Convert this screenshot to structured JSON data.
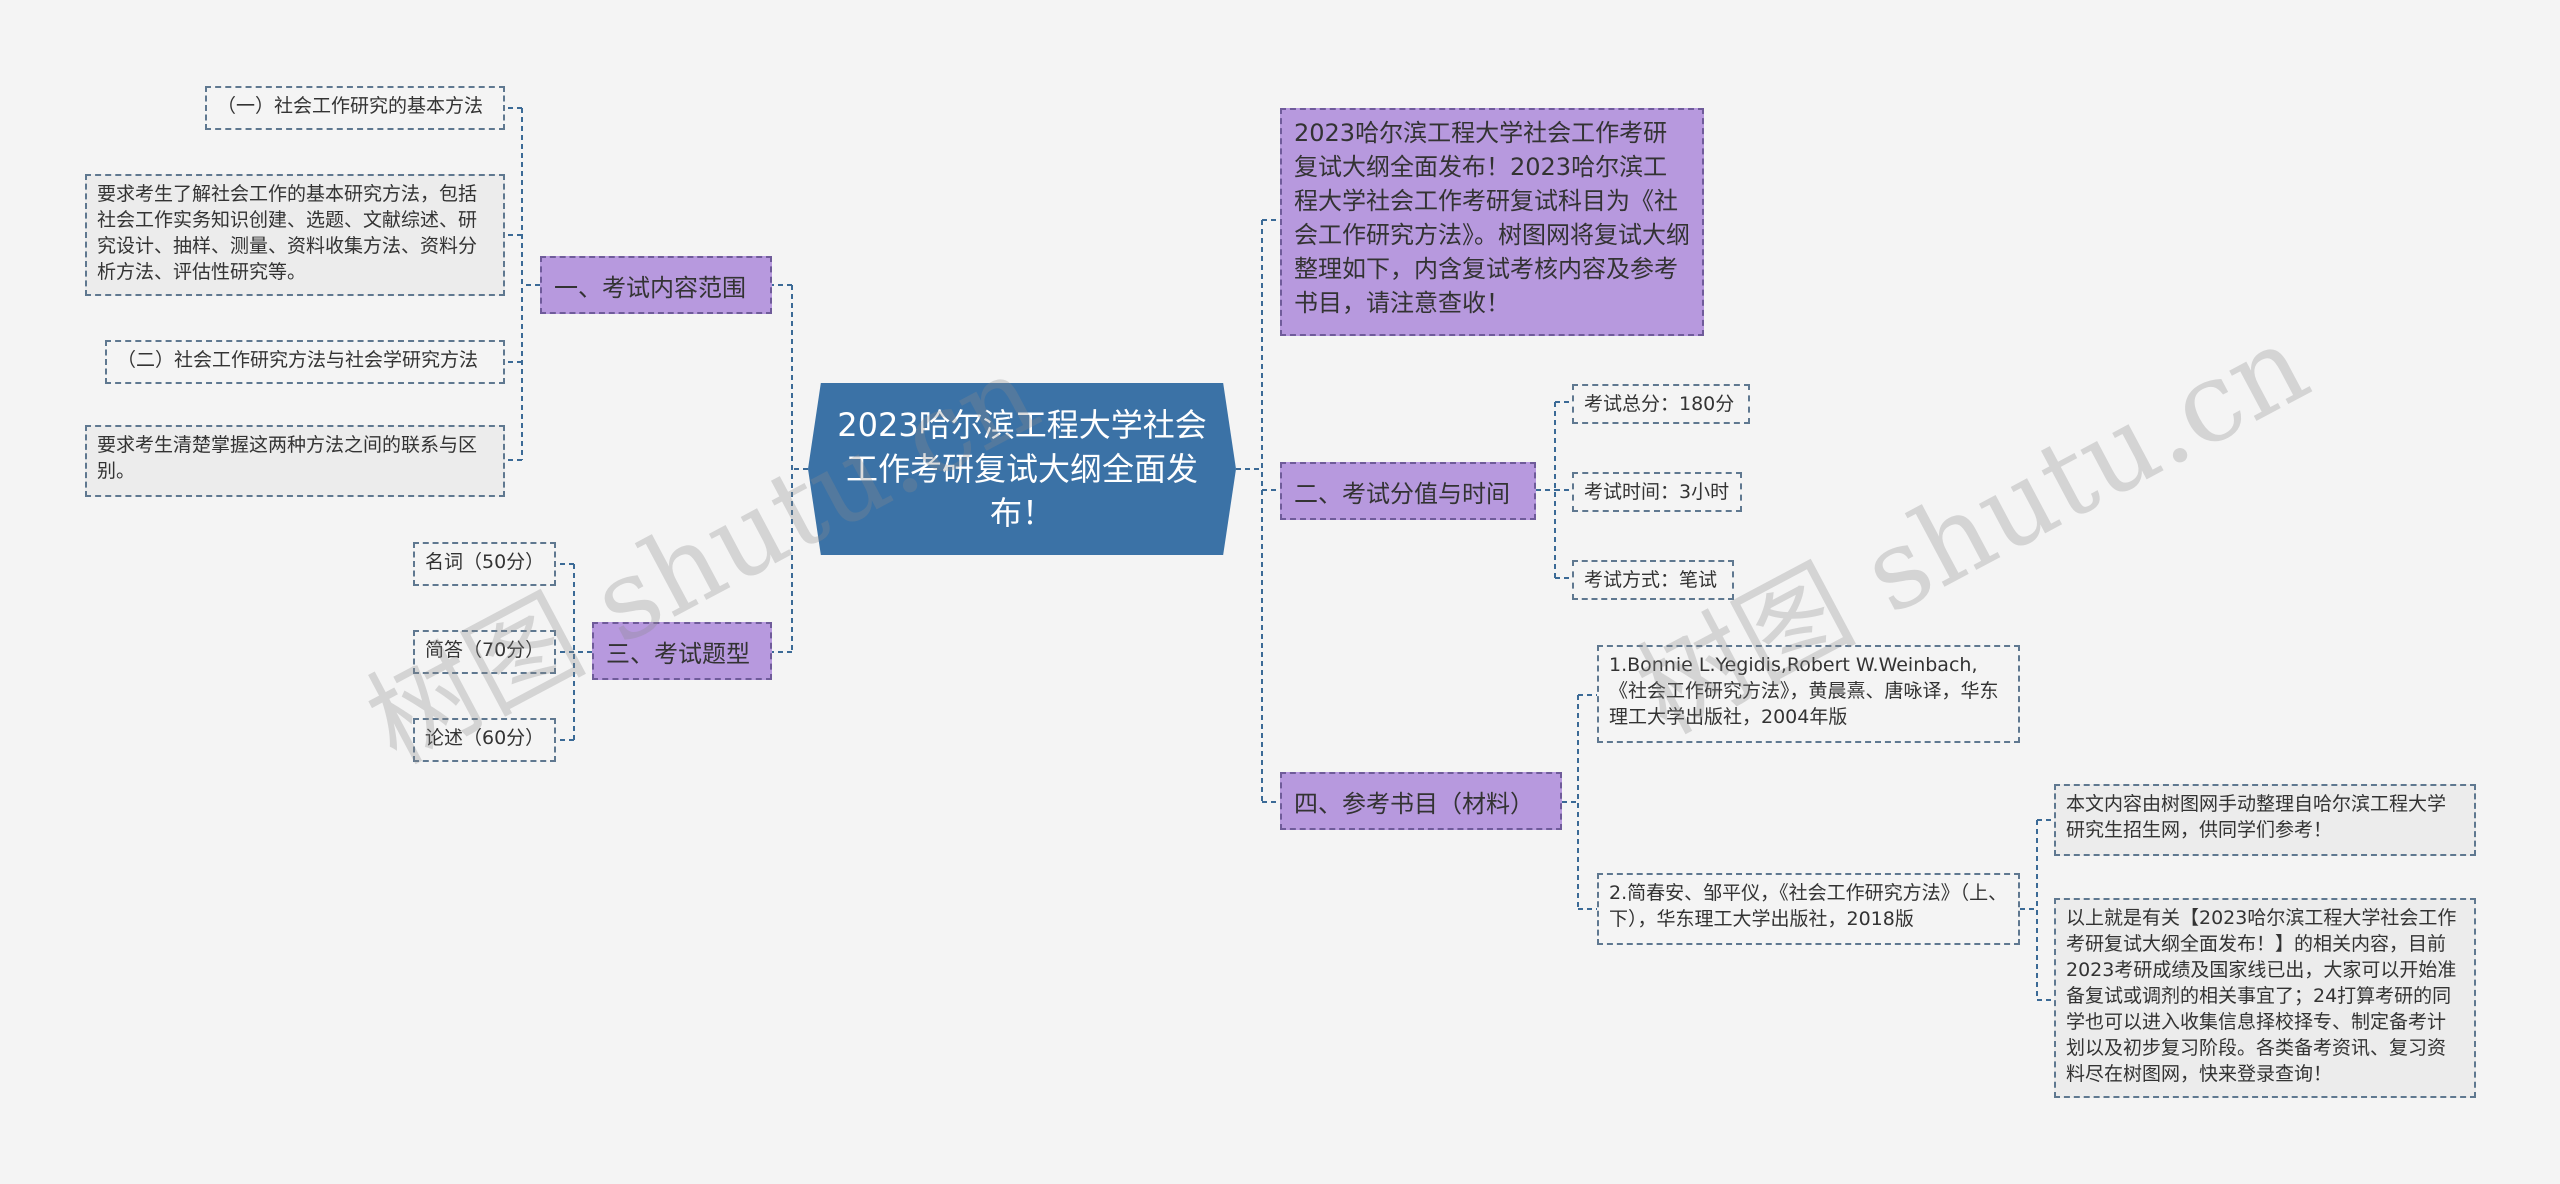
{
  "root": {
    "title": "2023哈尔滨工程大学社会工作考研复试大纲全面发布！"
  },
  "right": {
    "intro": "2023哈尔滨工程大学社会工作考研复试大纲全面发布！2023哈尔滨工程大学社会工作考研复试科目为《社会工作研究方法》。树图网将复试大纲整理如下，内含复试考核内容及参考书目，请注意查收！",
    "score": {
      "label": "二、考试分值与时间",
      "items": [
        "考试总分：180分",
        "考试时间：3小时",
        "考试方式：笔试"
      ]
    },
    "books": {
      "label": "四、参考书目（材料）",
      "items": [
        "1.Bonnie L.Yegidis,Robert W.Weinbach,《社会工作研究方法》，黄晨熹、唐咏译，华东理工大学出版社，2004年版",
        "2.简春安、邹平仪，《社会工作研究方法》（上、下），华东理工大学出版社，2018版"
      ],
      "notes": [
        "本文内容由树图网手动整理自哈尔滨工程大学研究生招生网，供同学们参考！",
        "以上就是有关【2023哈尔滨工程大学社会工作考研复试大纲全面发布！】的相关内容，目前2023考研成绩及国家线已出，大家可以开始准备复试或调剂的相关事宜了；24打算考研的同学也可以进入收集信息择校择专、制定备考计划以及初步复习阶段。各类备考资讯、复习资料尽在树图网，快来登录查询！"
      ]
    }
  },
  "left": {
    "scope": {
      "label": "一、考试内容范围",
      "items": [
        "（一）社会工作研究的基本方法",
        "要求考生了解社会工作的基本研究方法，包括社会工作实务知识创建、选题、文献综述、研究设计、抽样、测量、资料收集方法、资料分析方法、评估性研究等。",
        "（二）社会工作研究方法与社会学研究方法",
        "要求考生清楚掌握这两种方法之间的联系与区别。"
      ]
    },
    "types": {
      "label": "三、考试题型",
      "items": [
        "名词（50分）",
        "简答（70分）",
        "论述（60分）"
      ]
    }
  },
  "watermarks": [
    "树图 shutu.cn",
    "树图 shutu.cn"
  ],
  "colors": {
    "root": "#3b72a6",
    "branch": "#b799de",
    "line": "#3b6a96",
    "background": "#f4f4f4"
  }
}
